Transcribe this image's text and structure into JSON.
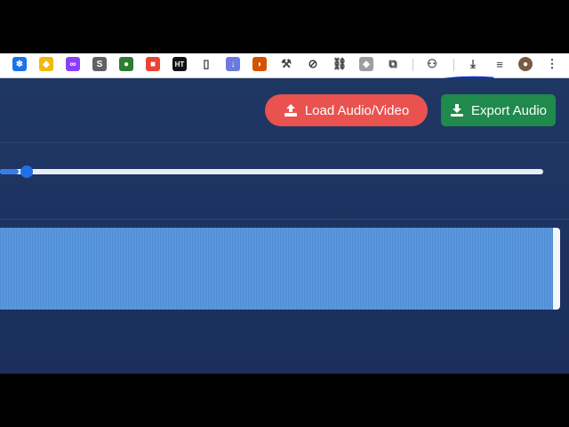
{
  "toolbar": {
    "extensions": [
      {
        "name": "snowflake-ext-icon",
        "glyph": "❄",
        "bg": "#1a73e8"
      },
      {
        "name": "diamond-ext-icon",
        "glyph": "◆",
        "bg": "#f0b90b"
      },
      {
        "name": "infinity-ext-icon",
        "glyph": "∞",
        "bg": "#8a3ffc"
      },
      {
        "name": "shield-s-ext-icon",
        "glyph": "S",
        "bg": "#5f6368"
      },
      {
        "name": "globe-ext-icon",
        "glyph": "●",
        "bg": "#2e7d32"
      },
      {
        "name": "puzzle-color-ext-icon",
        "glyph": "■",
        "bg": "#ea4335"
      },
      {
        "name": "ht-ext-icon",
        "glyph": "HT",
        "bg": "#111111"
      },
      {
        "name": "bookmark-ext-icon",
        "glyph": "▯",
        "bg": "#ffffff"
      },
      {
        "name": "download-arrow-ext-icon",
        "glyph": "↓",
        "bg": "#6c7ae0"
      },
      {
        "name": "leaf-ext-icon",
        "glyph": "◗",
        "bg": "#d35400"
      },
      {
        "name": "tools-ext-icon",
        "glyph": "⚒",
        "bg": "#ffffff"
      },
      {
        "name": "no-circle-ext-icon",
        "glyph": "⊘",
        "bg": "#ffffff"
      },
      {
        "name": "link-ext-icon",
        "glyph": "⛓",
        "bg": "#ffffff"
      },
      {
        "name": "badge-ext-icon",
        "glyph": "◈",
        "bg": "#9e9e9e"
      },
      {
        "name": "extensions-puzzle-icon",
        "glyph": "⧉",
        "bg": "#ffffff"
      },
      {
        "name": "incognito-icon",
        "glyph": "⚇",
        "bg": "#ffffff"
      },
      {
        "name": "downloads-icon",
        "glyph": "⤓",
        "bg": "#ffffff"
      },
      {
        "name": "media-queue-icon",
        "glyph": "≡",
        "bg": "#ffffff"
      },
      {
        "name": "profile-avatar",
        "glyph": "●",
        "bg": "#7b5a44"
      },
      {
        "name": "kebab-menu-icon",
        "glyph": "⋮",
        "bg": "#ffffff"
      }
    ]
  },
  "buttons": {
    "load_label": "Load Audio/Video",
    "export_label": "Export Audio"
  },
  "colors": {
    "load_button": "#e9524f",
    "export_button": "#1f8a4b",
    "background": "#1e3260",
    "slider_thumb": "#1f6fe8",
    "waveform": "#4f8dd4",
    "annotation_stroke": "#1030d8"
  },
  "timeline": {
    "position_fraction": 0.035
  }
}
